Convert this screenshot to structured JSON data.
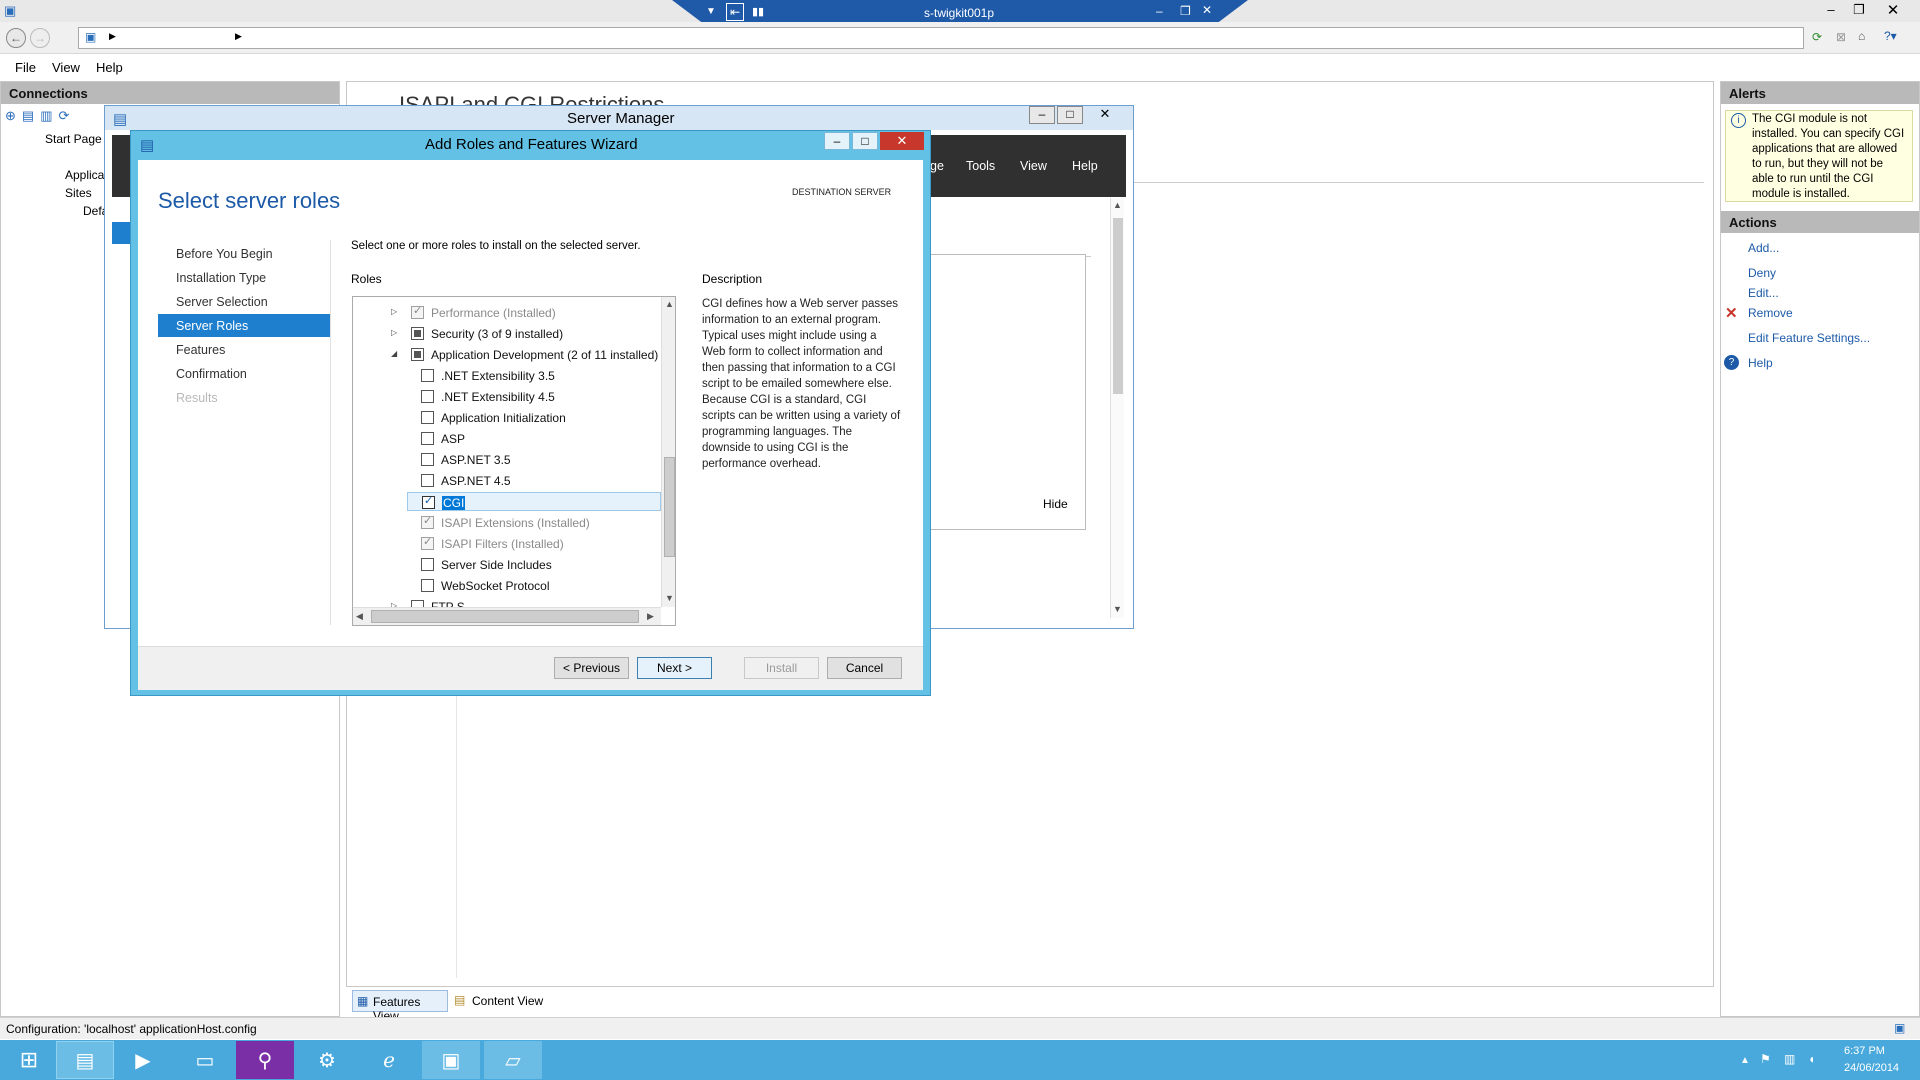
{
  "rdp": {
    "host": "s-twigkit001p"
  },
  "iis": {
    "menus": [
      "File",
      "View",
      "Help"
    ],
    "connections_title": "Connections",
    "tree": {
      "start_page": "Start Page",
      "app_pools": "Applica",
      "sites": "Sites",
      "default_site": "Defa"
    },
    "center_title": "ISAPI and CGI Restrictions",
    "bottom_tabs": {
      "features": "Features View",
      "content": "Content View"
    },
    "alerts_title": "Alerts",
    "alert_text": "The CGI module is not installed. You can specify CGI applications that are allowed to run, but they will not be able to run until the CGI module is installed.",
    "actions_title": "Actions",
    "actions": [
      "Add...",
      "Deny",
      "Edit...",
      "Remove",
      "Edit Feature Settings...",
      "Help"
    ],
    "status": "Configuration: 'localhost' applicationHost.config"
  },
  "server_manager": {
    "title": "Server Manager",
    "menus": [
      "ge",
      "Tools",
      "View",
      "Help"
    ],
    "hide_label": "Hide"
  },
  "wizard": {
    "title": "Add Roles and Features Wizard",
    "heading": "Select server roles",
    "destination_label": "DESTINATION SERVER",
    "nav": [
      "Before You Begin",
      "Installation Type",
      "Server Selection",
      "Server Roles",
      "Features",
      "Confirmation",
      "Results"
    ],
    "active_nav": "Server Roles",
    "instruction": "Select one or more roles to install on the selected server.",
    "roles_header": "Roles",
    "roles": [
      {
        "label": "Performance (Installed)",
        "state": "installed",
        "indent": 1,
        "expand": "right"
      },
      {
        "label": "Security (3 of 9 installed)",
        "state": "partial",
        "indent": 1,
        "expand": "right"
      },
      {
        "label": "Application Development (2 of 11 installed)",
        "state": "partial",
        "indent": 1,
        "expand": "down"
      },
      {
        "label": ".NET Extensibility 3.5",
        "state": "unchecked",
        "indent": 2
      },
      {
        "label": ".NET Extensibility 4.5",
        "state": "unchecked",
        "indent": 2
      },
      {
        "label": "Application Initialization",
        "state": "unchecked",
        "indent": 2
      },
      {
        "label": "ASP",
        "state": "unchecked",
        "indent": 2
      },
      {
        "label": "ASP.NET 3.5",
        "state": "unchecked",
        "indent": 2
      },
      {
        "label": "ASP.NET 4.5",
        "state": "unchecked",
        "indent": 2
      },
      {
        "label": "CGI",
        "state": "checked",
        "indent": 2,
        "selected": true
      },
      {
        "label": "ISAPI Extensions (Installed)",
        "state": "installed",
        "indent": 2
      },
      {
        "label": "ISAPI Filters (Installed)",
        "state": "installed",
        "indent": 2
      },
      {
        "label": "Server Side Includes",
        "state": "unchecked",
        "indent": 2
      },
      {
        "label": "WebSocket Protocol",
        "state": "unchecked",
        "indent": 2
      },
      {
        "label": "FTP S",
        "state": "unchecked",
        "indent": 1,
        "expand": "right"
      }
    ],
    "description_header": "Description",
    "description": "CGI defines how a Web server passes information to an external program. Typical uses might include using a Web form to collect information and then passing that information to a CGI script to be emailed somewhere else. Because CGI is a standard, CGI scripts can be written using a variety of programming languages. The downside to using CGI is the performance overhead.",
    "buttons": {
      "previous": "< Previous",
      "next": "Next >",
      "install": "Install",
      "cancel": "Cancel"
    }
  },
  "taskbar": {
    "time": "6:37 PM",
    "date": "24/06/2014"
  },
  "colors": {
    "accent": "#0078d7",
    "wizard_frame": "#62c1e5",
    "taskbar": "#4aa9dc",
    "link": "#1c5aa8"
  }
}
